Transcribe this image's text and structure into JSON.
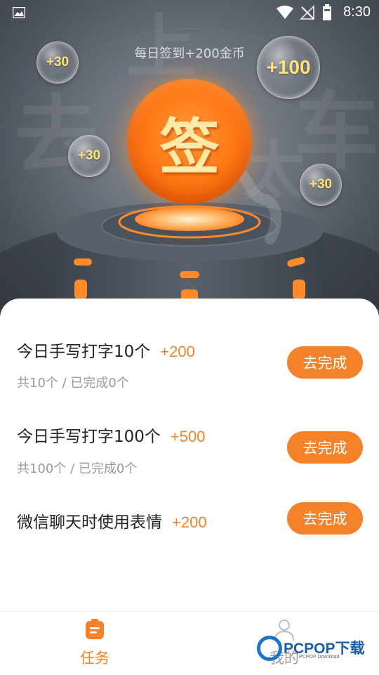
{
  "status_bar": {
    "time": "8:30",
    "icons": [
      "image-icon",
      "wifi-icon",
      "no-signal-icon",
      "battery-icon"
    ]
  },
  "hero": {
    "subtitle": "每日签到+200金币",
    "sign_button_label": "签",
    "bubbles": [
      "+30",
      "+100",
      "+30",
      "+30"
    ]
  },
  "tasks": [
    {
      "title": "今日手写打字10个",
      "reward": "+200",
      "progress": "共10个 / 已完成0个",
      "button": "去完成"
    },
    {
      "title": "今日手写打字100个",
      "reward": "+500",
      "progress": "共100个 / 已完成0个",
      "button": "去完成"
    },
    {
      "title": "微信聊天时使用表情",
      "reward": "+200",
      "button": "去完成"
    }
  ],
  "tabs": [
    {
      "label": "任务",
      "icon": "task-clipboard-icon",
      "active": true
    },
    {
      "label": "我的",
      "icon": "person-icon",
      "active": false
    }
  ],
  "watermark": {
    "text": "PCPOP下载",
    "sub": "PCPOP Download"
  },
  "colors": {
    "accent": "#f5822a",
    "tab_active": "#f5822a",
    "tab_inactive": "#999999",
    "hero_bg": "#5f656e"
  }
}
